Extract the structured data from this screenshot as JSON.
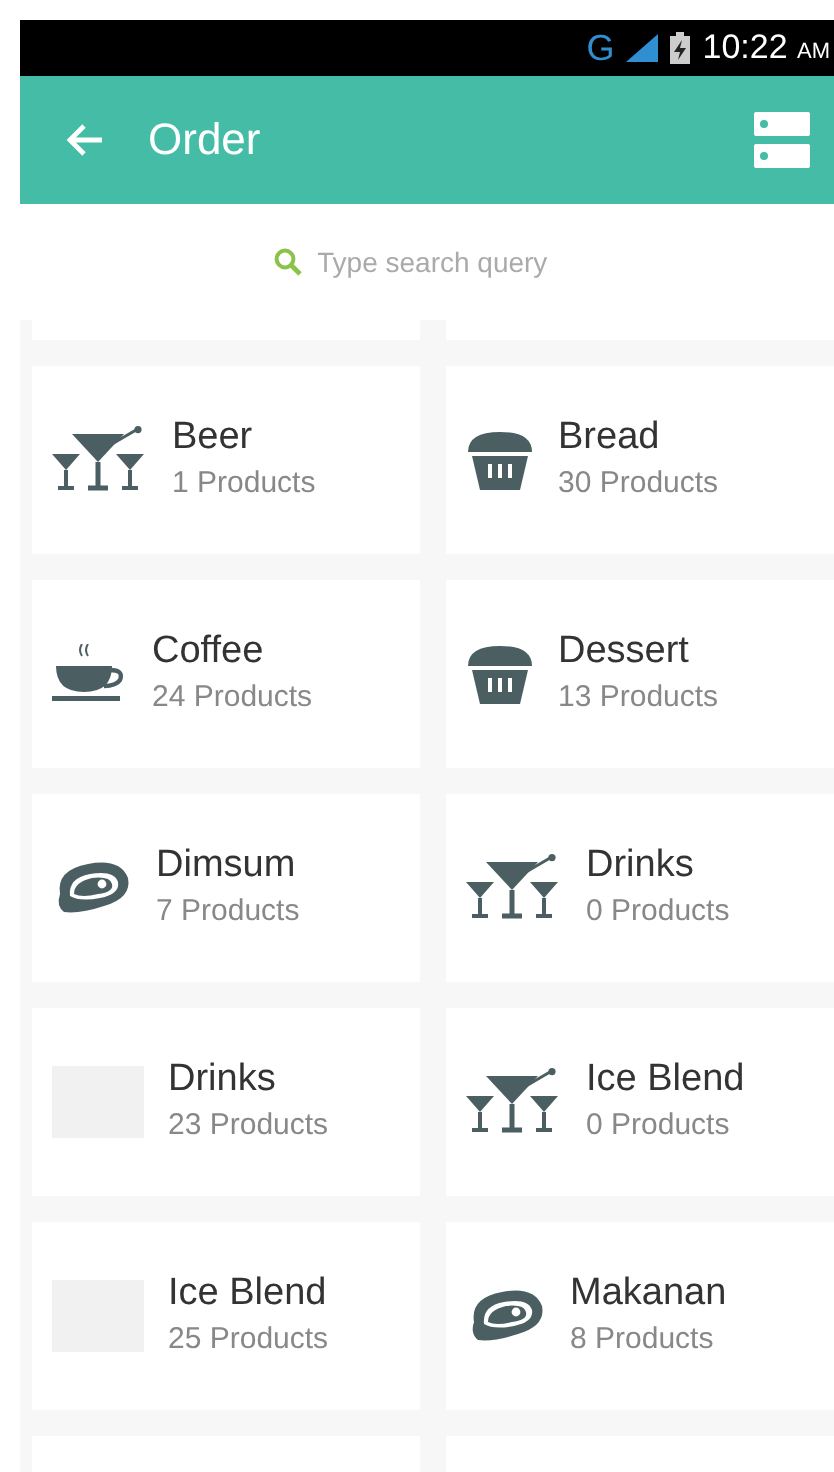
{
  "status_bar": {
    "network": "G",
    "time": "10:22",
    "meridiem": "AM"
  },
  "app_bar": {
    "title": "Order"
  },
  "search": {
    "placeholder": "Type search query"
  },
  "categories": [
    {
      "name": "Beer",
      "count": "1 Products",
      "kind": "cocktail"
    },
    {
      "name": "Bread",
      "count": "30 Products",
      "kind": "cupcake"
    },
    {
      "name": "Coffee",
      "count": "24 Products",
      "kind": "coffee"
    },
    {
      "name": "Dessert",
      "count": "13 Products",
      "kind": "cupcake"
    },
    {
      "name": "Dimsum",
      "count": "7 Products",
      "kind": "steak"
    },
    {
      "name": "Drinks",
      "count": "0 Products",
      "kind": "cocktail"
    },
    {
      "name": "Drinks",
      "count": "23 Products",
      "kind": "logo"
    },
    {
      "name": "Ice Blend",
      "count": "0 Products",
      "kind": "cocktail"
    },
    {
      "name": "Ice Blend",
      "count": "25 Products",
      "kind": "logo"
    },
    {
      "name": "Makanan",
      "count": "8 Products",
      "kind": "steak"
    }
  ]
}
